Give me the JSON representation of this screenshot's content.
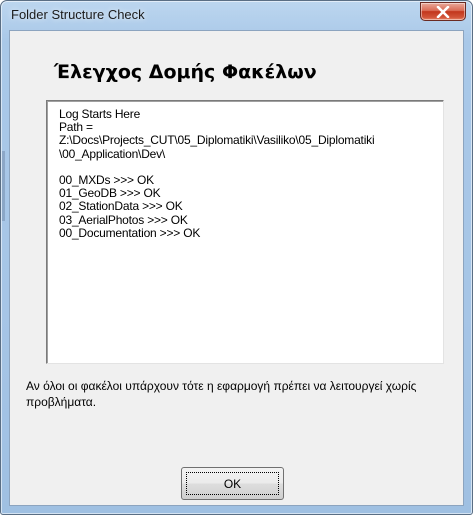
{
  "window": {
    "title": "Folder Structure Check",
    "close_icon": "close-x-icon"
  },
  "dialog": {
    "heading": "Έλεγχος Δομής Φακέλων",
    "log": [
      "Log Starts Here",
      "Path =",
      "Z:\\Docs\\Projects_CUT\\05_Diplomatiki\\Vasiliko\\05_Diplomatiki",
      "\\00_Application\\Dev\\",
      "",
      "00_MXDs >>> OK",
      "01_GeoDB >>> OK",
      "02_StationData >>> OK",
      "03_AerialPhotos >>> OK",
      "00_Documentation >>> OK"
    ],
    "note": "Αν όλοι οι φακέλοι υπάρχουν τότε η εφαρμογή πρέπει να λειτουργεί χωρίς προβλήματα.",
    "ok_label": "OK"
  },
  "colors": {
    "frame": "#a6c5e6",
    "client": "#f0f0f0",
    "close_button": "#c2361c"
  }
}
